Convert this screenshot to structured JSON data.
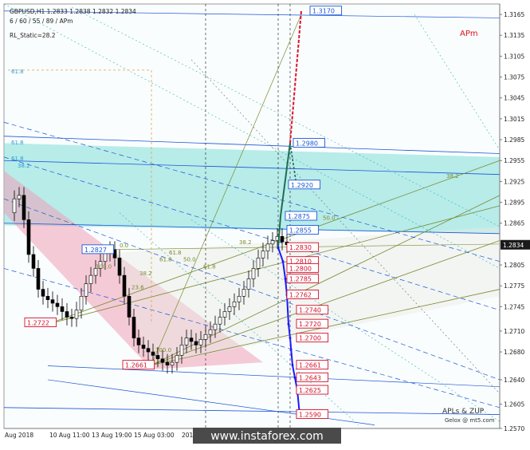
{
  "header": {
    "symbol_line": "GBPUSD,H1  1.2833 1.2838 1.2832 1.2834",
    "periods_line": "6 / 60 / 55 / 89 / APm",
    "indicator_line": "RL_Static=28.2"
  },
  "corner_label": "APm",
  "footer": {
    "credit1": "APLs & ZUP",
    "credit2": "Gelox @ mt5.com",
    "watermark": "www.instaforex.com"
  },
  "colors": {
    "background": "#ffffff",
    "teal_zone": "#7fded9",
    "pink_zone": "#f0a0b8",
    "bull_candle": "#ffffff",
    "bear_candle": "#000000",
    "red_path": "#e0102a",
    "blue_path": "#1a1aff",
    "green_path": "#1e6e54",
    "price_tag": "#1a1a1a"
  },
  "chart_data": {
    "type": "candlestick",
    "symbol": "GBPUSD",
    "timeframe": "H1",
    "last_price": "1.2834",
    "ylim": [
      1.257,
      1.318
    ],
    "y_ticks": [
      "1.3165",
      "1.3135",
      "1.3105",
      "1.3075",
      "1.3045",
      "1.3015",
      "1.2985",
      "1.2955",
      "1.2925",
      "1.2895",
      "1.2865",
      "1.2834",
      "1.2805",
      "1.2775",
      "1.2745",
      "1.2710",
      "1.2680",
      "1.2640",
      "1.2605",
      "1.2570"
    ],
    "x_ticks": [
      "Aug 2018",
      "10 Aug 11:00",
      "13 Aug 19:00",
      "15 Aug 03:00",
      "2018"
    ],
    "price_series": [
      1.288,
      1.29,
      1.2905,
      1.287,
      1.282,
      1.28,
      1.277,
      1.276,
      1.2755,
      1.275,
      1.2745,
      1.2738,
      1.273,
      1.2728,
      1.274,
      1.276,
      1.2778,
      1.279,
      1.28,
      1.281,
      1.2822,
      1.2827,
      1.2815,
      1.279,
      1.276,
      1.273,
      1.27,
      1.269,
      1.2685,
      1.268,
      1.2675,
      1.267,
      1.2665,
      1.2661,
      1.2665,
      1.2675,
      1.269,
      1.27,
      1.2695,
      1.269,
      1.2698,
      1.2705,
      1.2712,
      1.272,
      1.273,
      1.2738,
      1.2745,
      1.2752,
      1.276,
      1.277,
      1.2785,
      1.28,
      1.2815,
      1.2825,
      1.2835,
      1.284,
      1.2846,
      1.2838,
      1.2834
    ],
    "swing_labels": [
      "1.2827",
      "1.2722",
      "1.2661"
    ],
    "level_labels": [
      "1.3170",
      "1.2980",
      "1.2920",
      "1.2875",
      "1.2855",
      "1.2830",
      "1.2810",
      "1.2800",
      "1.2785",
      "1.2762",
      "1.2740",
      "1.2720",
      "1.2700",
      "1.2661",
      "1.2643",
      "1.2625",
      "1.2590"
    ],
    "up_path": [
      "1.2830",
      "1.2875",
      "1.2980",
      "1.3170"
    ],
    "down_path": [
      "1.2830",
      "1.2810",
      "1.2785",
      "1.2762",
      "1.2720",
      "1.2700",
      "1.2661",
      "1.2643",
      "1.2625",
      "1.2590"
    ],
    "fib_labels": [
      "61.8",
      "61.8",
      "61.8",
      "38.2",
      "100.0",
      "61.8",
      "38.2",
      "23.6",
      "0.0",
      "61.8",
      "50.0",
      "38.2",
      "61.8",
      "50.0",
      "38.2",
      "100.0"
    ],
    "zones": [
      {
        "name": "teal-zone",
        "from": 1.2855,
        "to": 1.298
      },
      {
        "name": "pink-zone",
        "from": 1.2661,
        "to": 1.2905
      }
    ]
  }
}
